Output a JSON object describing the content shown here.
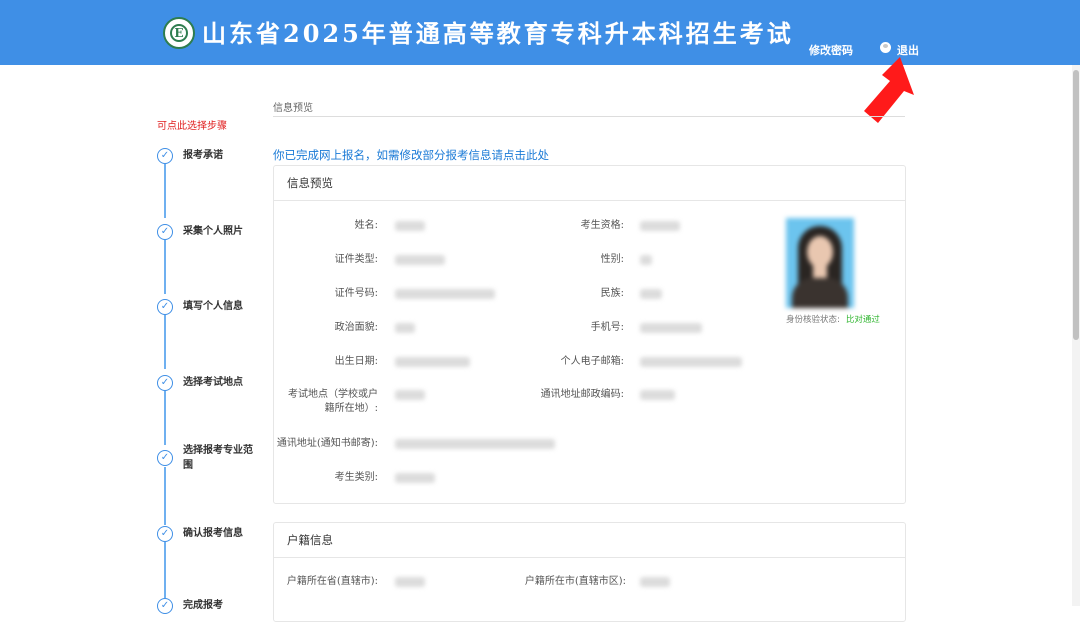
{
  "header": {
    "title": "山东省2025年普通高等教育专科升本科招生考试",
    "change_password": "修改密码",
    "logout": "退出",
    "logo_letter": "E"
  },
  "sidebar": {
    "hint": "可点此选择步骤",
    "steps": [
      {
        "label": "报考承诺",
        "icon": "check-circle-icon"
      },
      {
        "label": "采集个人照片",
        "icon": "check-circle-icon"
      },
      {
        "label": "填写个人信息",
        "icon": "check-circle-icon"
      },
      {
        "label": "选择考试地点",
        "icon": "check-circle-icon"
      },
      {
        "label": "选择报考专业范围",
        "icon": "check-circle-icon"
      },
      {
        "label": "确认报考信息",
        "icon": "check-circle-icon"
      },
      {
        "label": "完成报考",
        "icon": "check-circle-icon"
      }
    ]
  },
  "main": {
    "tab": "信息预览",
    "notice": "你已完成网上报名，如需修改部分报考信息请点击此处",
    "preview": {
      "title": "信息预览",
      "fields_left": [
        "姓名:",
        "证件类型:",
        "证件号码:",
        "政治面貌:",
        "出生日期:",
        "考试地点（学校或户籍所在地）:",
        "通讯地址(通知书邮寄):",
        "考生类别:"
      ],
      "fields_right": [
        "考生资格:",
        "性别:",
        "民族:",
        "手机号:",
        "个人电子邮箱:",
        "通讯地址邮政编码:"
      ],
      "verify_label": "身份核验状态:",
      "verify_status": "比对通过"
    },
    "household": {
      "title": "户籍信息",
      "province_label": "户籍所在省(直辖市):",
      "city_label": "户籍所在市(直辖市区):"
    }
  },
  "colors": {
    "header_bg": "#3f8fe6",
    "accent": "#3f8fe6",
    "hint_red": "#e02020",
    "notice_blue": "#1a7ad6",
    "verify_green": "#2fb52f",
    "arrow_red": "#ff1a1a"
  }
}
